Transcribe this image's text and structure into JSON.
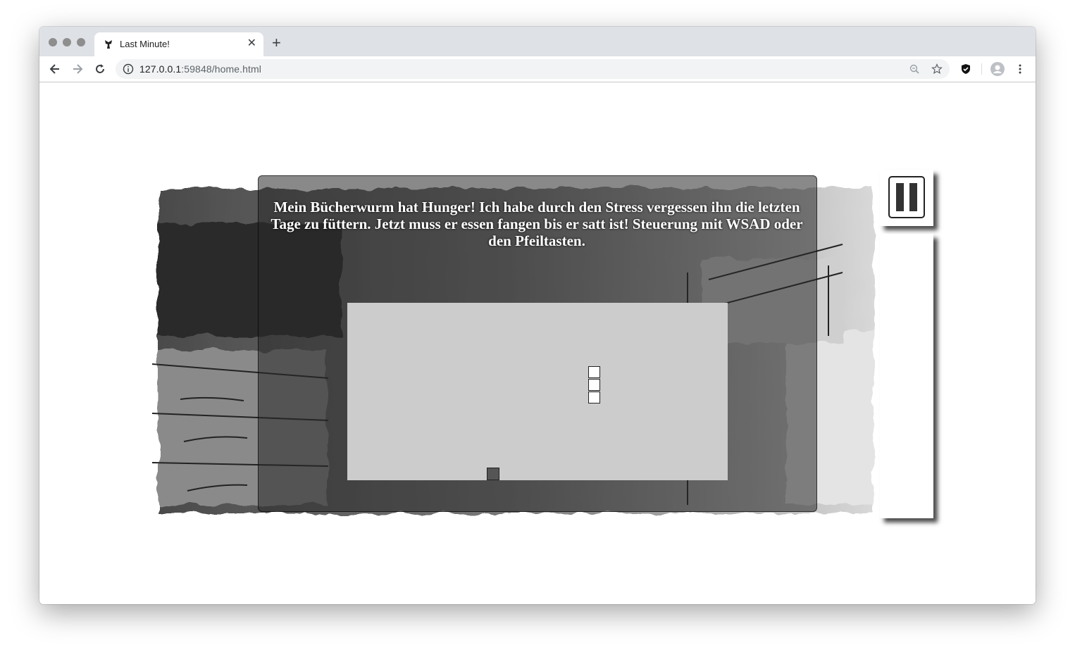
{
  "browser": {
    "tab_title": "Last Minute!",
    "url_host": "127.0.0.1",
    "url_rest": ":59848/home.html",
    "icons": [
      "back-icon",
      "forward-icon",
      "reload-icon",
      "info-icon",
      "zoom-icon",
      "star-icon",
      "shield-extension-icon",
      "profile-icon",
      "menu-icon",
      "close-icon",
      "new-tab-icon"
    ]
  },
  "game": {
    "story": "Mein Bücherwurm hat Hunger! Ich habe durch den Stress vergessen ihn die letzten Tage zu füttern. Jetzt muss er essen fangen bis er satt ist! Steuerung mit WSAD oder den Pfeiltasten.",
    "pause_icon": "pause-icon",
    "colors": {
      "field": "#cccccc",
      "dialog": "#333333",
      "food": "#555555"
    }
  }
}
